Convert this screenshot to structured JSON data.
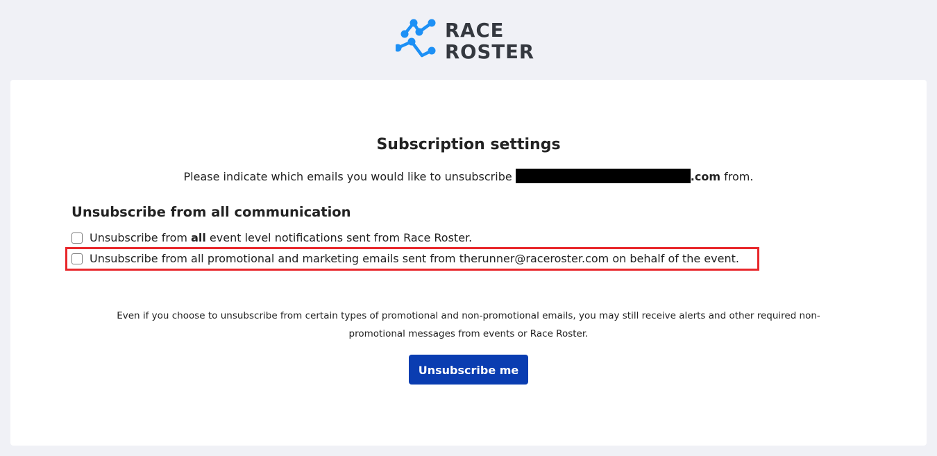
{
  "brand": {
    "logo_line1": "RACE",
    "logo_line2": "ROSTER",
    "logo_icon": "race-roster-logo-icon",
    "accent_color": "#1d90f5"
  },
  "page": {
    "title": "Subscription settings",
    "subtitle_before": "Please indicate which emails you would like to unsubscribe",
    "email_domain": ".com",
    "subtitle_after": "from."
  },
  "section": {
    "heading": "Unsubscribe from all communication"
  },
  "options": [
    {
      "label_before": "Unsubscribe from",
      "label_bold": "all",
      "label_after": "event level notifications sent from Race Roster.",
      "checked": false
    },
    {
      "label": "Unsubscribe from all promotional and marketing emails sent from therunner@raceroster.com on behalf of the event.",
      "checked": false,
      "highlighted": true
    }
  ],
  "note": {
    "text": "Even if you choose to unsubscribe from certain types of promotional and non-promotional emails, you may still receive alerts and other required non-promotional messages from events or Race Roster."
  },
  "button": {
    "label": "Unsubscribe me",
    "color": "#0a3db1"
  },
  "highlight_color": "#e8262a"
}
